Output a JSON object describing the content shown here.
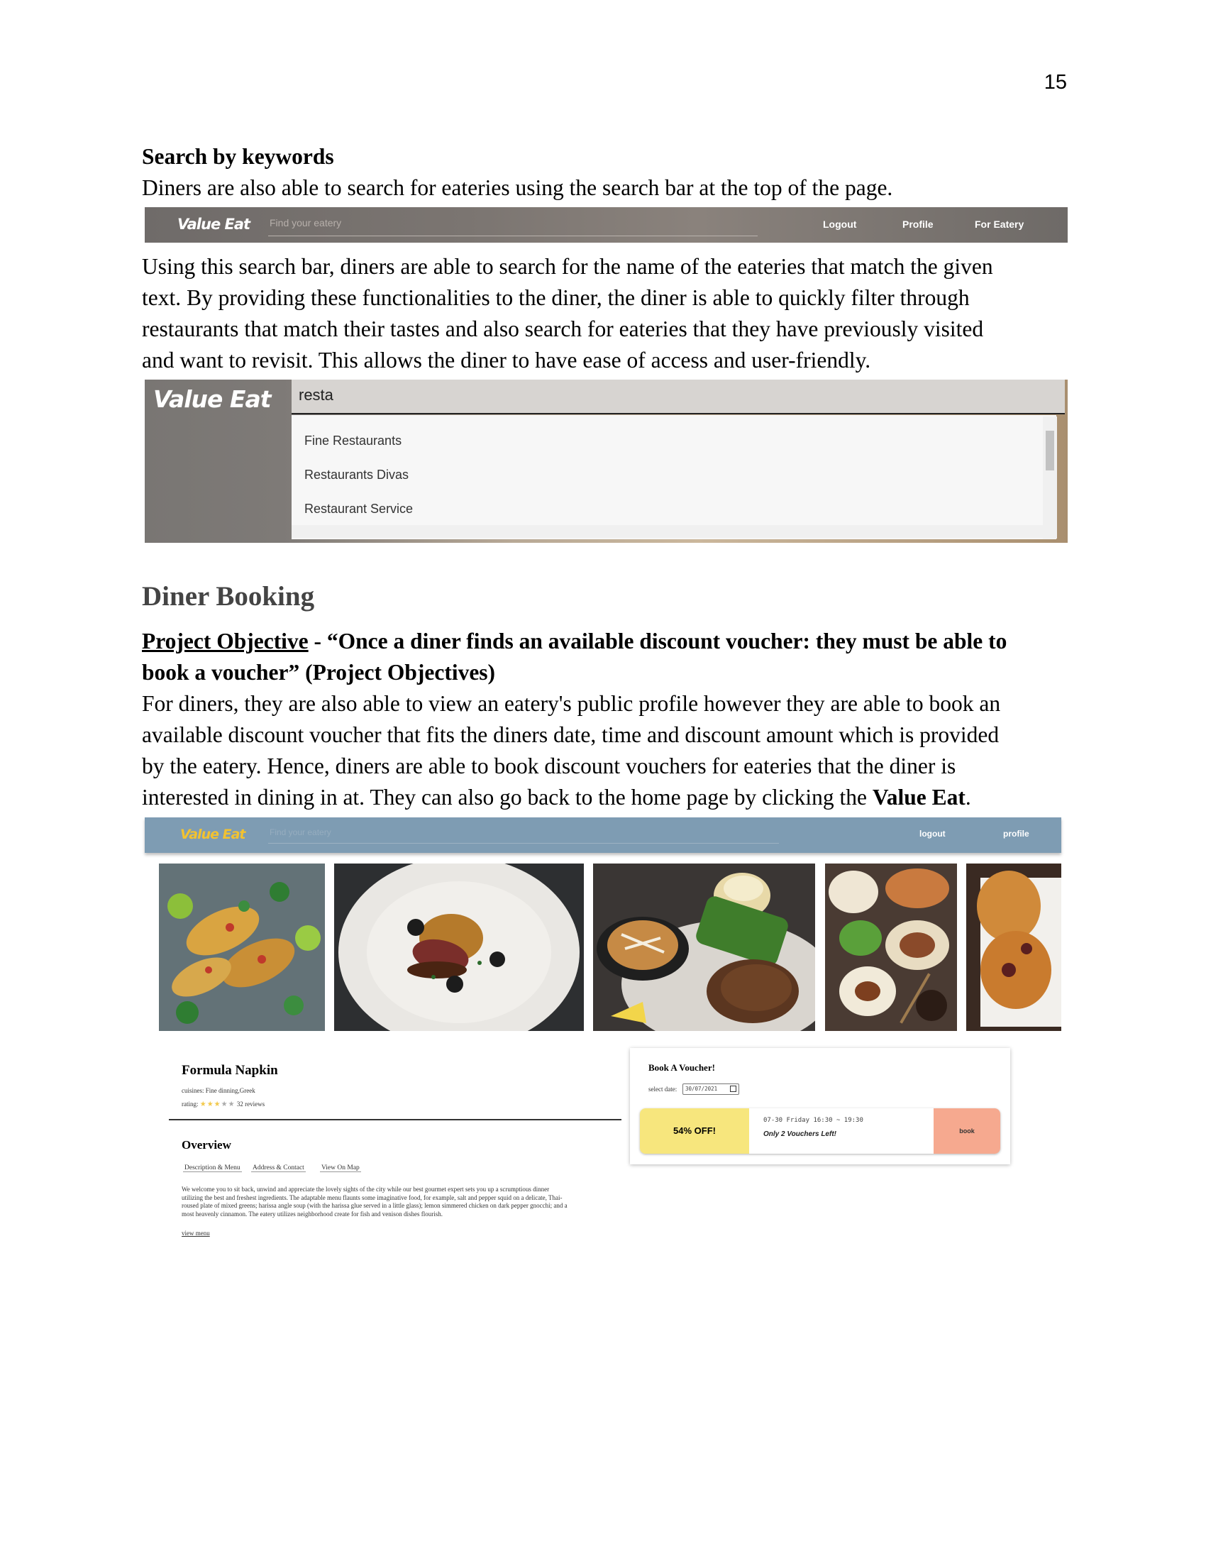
{
  "page_number": "15",
  "search_section": {
    "heading": "Search by keywords",
    "intro": "Diners are also able to search for eateries using the search bar at the top of the page.",
    "paragraph_lines": [
      "Using this search bar, diners are able to search for the name of the eateries that match the given",
      "text. By providing these functionalities to the diner, the diner is able to quickly filter through",
      "restaurants that match their tastes and also search for eateries that they have previously visited",
      "and want to revisit. This allows the diner to have ease of access and user-friendly."
    ]
  },
  "nav1": {
    "logo": "Value Eat",
    "search_placeholder": "Find your eatery",
    "links": [
      "Logout",
      "Profile",
      "For Eatery"
    ]
  },
  "search_demo": {
    "logo": "Value Eat",
    "query": "resta",
    "suggestions": [
      "Fine Restaurants",
      "Restaurants Divas",
      "Restaurant Service"
    ]
  },
  "booking_section": {
    "heading": "Diner Booking",
    "objective_label": "Project Objective",
    "objective_text_1": " - “Once a diner finds an available discount voucher: they must be able to",
    "objective_text_2": "book a voucher” (Project Objectives)",
    "paragraph_lines": [
      "For diners, they are also able to view an eatery's public profile however they are able to book an",
      "available discount voucher that fits the diners date, time and discount amount which is provided",
      "by the eatery. Hence, diners are able to book discount vouchers for eateries that the diner is"
    ],
    "last_line_start": "interested in dining in at. They can also go back to the home page by clicking the ",
    "last_line_bold": "Value Eat",
    "last_line_end": "."
  },
  "eatery_page": {
    "nav": {
      "logo": "Value Eat",
      "search_placeholder": "Find your eatery",
      "links": [
        "logout",
        "profile"
      ]
    },
    "restaurant": {
      "name": "Formula Napkin",
      "cuisines": "cuisines: Fine dinning,Greek",
      "rating_label": "rating:",
      "stars": "★★★★★",
      "rating_value": 3,
      "reviews": "32 reviews"
    },
    "overview": {
      "title": "Overview",
      "tabs": [
        "Description & Menu",
        "Address & Contact",
        "View On Map"
      ],
      "description": "We welcome you to sit back, unwind and appreciate the lovely sights of the city while our best gourmet expert sets you up a scrumptious dinner utilizing the best and freshest ingredients. The adaptable menu flaunts some imaginative food, for example, salt and pepper squid on a delicate, Thai-roused plate of mixed greens; harissa angle soup (with the harissa glue served in a little glass); lemon simmered chicken on dark pepper gnocchi; and a most heavenly cinnamon. The eatery utilizes neighborhood create for fish and venison dishes flourish.",
      "view_menu": "view menu"
    },
    "voucher": {
      "title": "Book A Voucher!",
      "select_date_label": "select date:",
      "date_value": "30/07/2021",
      "discount": "54% OFF!",
      "time": "07-30 Friday 16:30 ~ 19:30",
      "remaining": "Only 2 Vouchers Left!",
      "book_label": "book"
    }
  }
}
